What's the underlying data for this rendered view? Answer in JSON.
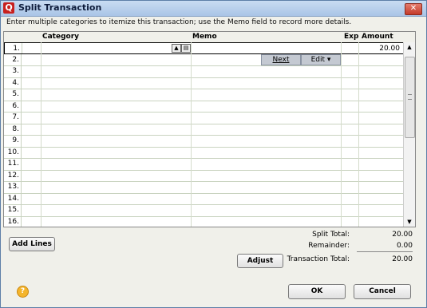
{
  "window": {
    "title": "Split Transaction",
    "icon_letter": "Q",
    "close_label": "✕"
  },
  "instructions": "Enter multiple categories to itemize this transaction; use the Memo field to record more details.",
  "columns": {
    "category": "Category",
    "memo": "Memo",
    "exp": "Exp",
    "amount": "Amount"
  },
  "rows": [
    {
      "num": "1.",
      "amount": "20.00"
    },
    {
      "num": "2.",
      "amount": ""
    },
    {
      "num": "3.",
      "amount": ""
    },
    {
      "num": "4.",
      "amount": ""
    },
    {
      "num": "5.",
      "amount": ""
    },
    {
      "num": "6.",
      "amount": ""
    },
    {
      "num": "7.",
      "amount": ""
    },
    {
      "num": "8.",
      "amount": ""
    },
    {
      "num": "9.",
      "amount": ""
    },
    {
      "num": "10.",
      "amount": ""
    },
    {
      "num": "11.",
      "amount": ""
    },
    {
      "num": "12.",
      "amount": ""
    },
    {
      "num": "13.",
      "amount": ""
    },
    {
      "num": "14.",
      "amount": ""
    },
    {
      "num": "15.",
      "amount": ""
    },
    {
      "num": "16.",
      "amount": ""
    }
  ],
  "row_buttons": {
    "next": "Next",
    "edit": "Edit"
  },
  "buttons": {
    "add_lines": "Add Lines",
    "adjust": "Adjust",
    "ok": "OK",
    "cancel": "Cancel"
  },
  "totals": {
    "split_total_label": "Split Total:",
    "split_total": "20.00",
    "remainder_label": "Remainder:",
    "remainder": "0.00",
    "transaction_total_label": "Transaction Total:",
    "transaction_total": "20.00"
  },
  "help_label": "?"
}
